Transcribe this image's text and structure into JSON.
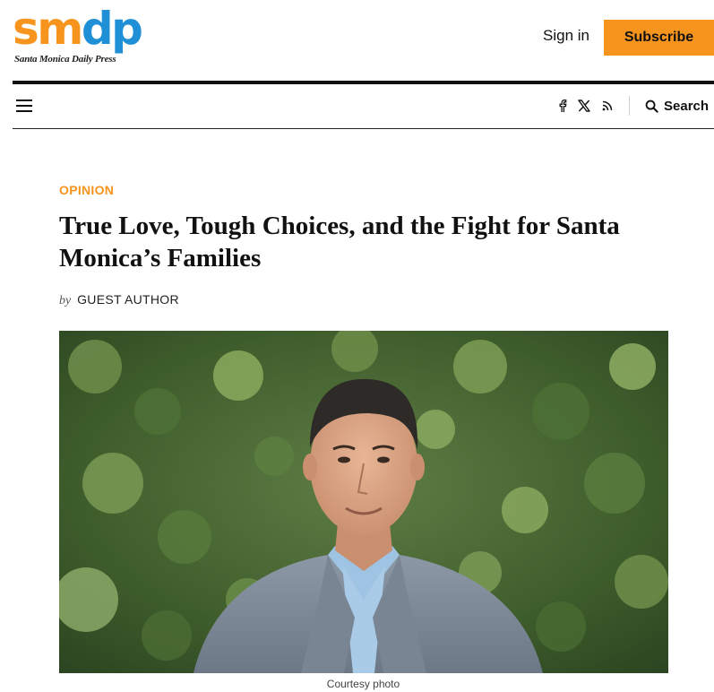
{
  "header": {
    "logo_word_orange": "sm",
    "logo_word_blue": "dp",
    "logo_tagline": "Santa Monica Daily Press",
    "signin_label": "Sign in",
    "subscribe_label": "Subscribe",
    "brand_colors": {
      "orange": "#f7941d",
      "blue": "#1f8fd6"
    }
  },
  "nav": {
    "menu_icon": "hamburger-icon",
    "social_icons": [
      "facebook-icon",
      "x-icon",
      "rss-icon"
    ],
    "search_label": "Search"
  },
  "article": {
    "category": "OPINION",
    "headline": "True Love, Tough Choices, and the Fight for Santa Monica’s Families",
    "byline_prefix": "by",
    "author": "GUEST AUTHOR",
    "photo_caption": "Courtesy photo"
  }
}
